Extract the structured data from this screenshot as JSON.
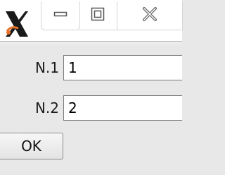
{
  "titlebar": {
    "app_icon": "x-app-icon",
    "minimize_icon": "minimize-icon",
    "maximize_icon": "maximize-icon",
    "close_icon": "close-icon"
  },
  "form": {
    "field1": {
      "label": "N.1",
      "value": "1"
    },
    "field2": {
      "label": "N.2",
      "value": "2"
    }
  },
  "buttons": {
    "ok_label": "OK"
  },
  "colors": {
    "background": "#e8e8e8",
    "titlebar": "#ffffff",
    "icon_accent": "#e8722a"
  }
}
